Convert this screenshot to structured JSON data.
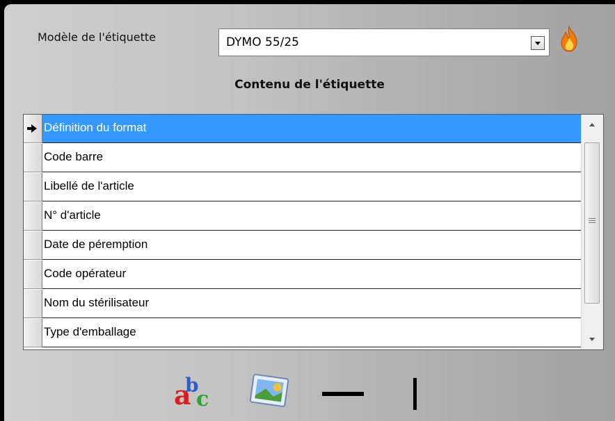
{
  "model": {
    "label": "Modèle de l'étiquette",
    "selected": "DYMO 55/25"
  },
  "content": {
    "title": "Contenu de l'étiquette",
    "rows": [
      {
        "label": "Définition du format",
        "selected": true
      },
      {
        "label": "Code barre"
      },
      {
        "label": "Libellé de l'article"
      },
      {
        "label": "N° d'article"
      },
      {
        "label": "Date de péremption"
      },
      {
        "label": "Code opérateur"
      },
      {
        "label": "Nom du stérilisateur"
      },
      {
        "label": "Type d'emballage"
      }
    ]
  },
  "icons": {
    "model_action": "fire-icon",
    "tools": [
      "add-text-icon",
      "add-image-icon",
      "horizontal-line-icon",
      "vertical-line-icon"
    ]
  },
  "colors": {
    "selection": "#3399ff"
  }
}
